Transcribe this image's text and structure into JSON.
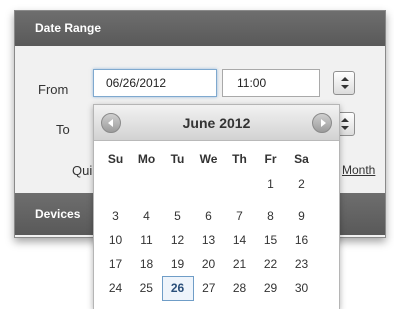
{
  "panel": {
    "title": "Date Range",
    "from_label": "From",
    "from_date": "06/26/2012",
    "from_time": "11:00",
    "to_label": "To",
    "quick_partial": "Qui",
    "month_link_partial": "Month",
    "devices_title": "Devices"
  },
  "datepicker": {
    "month_year": "June 2012",
    "weekdays": [
      "Su",
      "Mo",
      "Tu",
      "We",
      "Th",
      "Fr",
      "Sa"
    ],
    "weeks": [
      [
        "",
        "",
        "",
        "",
        "",
        "1",
        "2"
      ],
      [
        "3",
        "4",
        "5",
        "6",
        "7",
        "8",
        "9"
      ],
      [
        "10",
        "11",
        "12",
        "13",
        "14",
        "15",
        "16"
      ],
      [
        "17",
        "18",
        "19",
        "20",
        "21",
        "22",
        "23"
      ],
      [
        "24",
        "25",
        "26",
        "27",
        "28",
        "29",
        "30"
      ]
    ],
    "selected_day": "26",
    "prev_icon": "chevron-left-icon",
    "next_icon": "chevron-right-icon"
  }
}
